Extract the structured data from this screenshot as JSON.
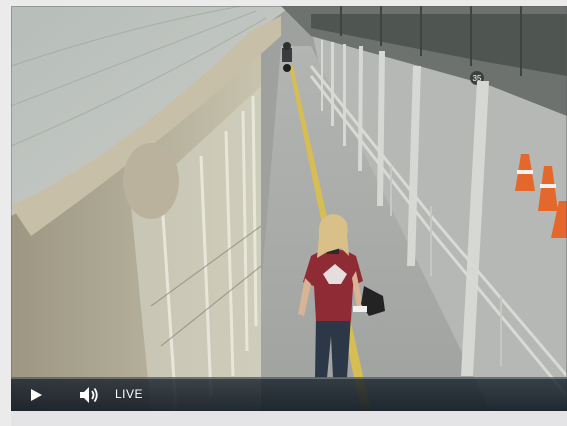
{
  "player": {
    "live_label": "LIVE",
    "play_icon": "play-icon",
    "volume_icon": "volume-icon"
  },
  "scene": {
    "sign_number": "35",
    "colors": {
      "pavement": "#a7aaa6",
      "canopy": "#b8bdb8",
      "yellow_line": "#d6bd54",
      "shirt": "#8e2b35",
      "hair": "#d9c089",
      "cone": "#e4682b"
    }
  }
}
